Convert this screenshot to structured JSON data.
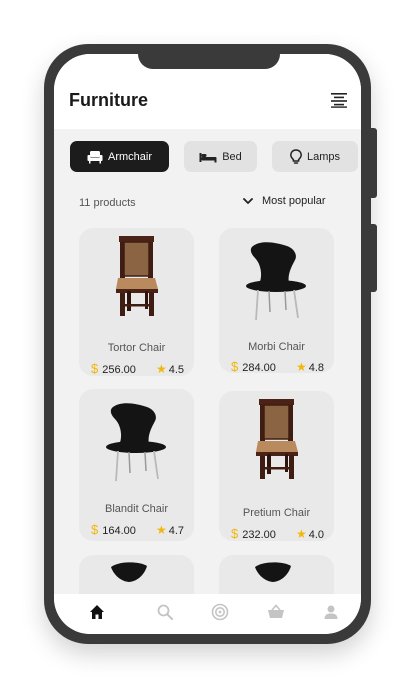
{
  "header": {
    "title": "Furniture"
  },
  "categories": [
    {
      "label": "Armchair",
      "icon": "armchair-icon",
      "active": true
    },
    {
      "label": "Bed",
      "icon": "bed-icon",
      "active": false
    },
    {
      "label": "Lamps",
      "icon": "lamp-icon",
      "active": false
    }
  ],
  "list": {
    "count": "11 products",
    "sort_label": "Most popular"
  },
  "products": [
    {
      "name": "Tortor Chair",
      "currency": "$",
      "price": "256.00",
      "rating": "4.5",
      "image": "wooden-chair"
    },
    {
      "name": "Morbi Chair",
      "currency": "$",
      "price": "284.00",
      "rating": "4.8",
      "image": "black-shell-chair"
    },
    {
      "name": "Blandit Chair",
      "currency": "$",
      "price": "164.00",
      "rating": "4.7",
      "image": "black-shell-chair"
    },
    {
      "name": "Pretium Chair",
      "currency": "$",
      "price": "232.00",
      "rating": "4.0",
      "image": "wooden-chair"
    }
  ],
  "tabs": [
    "home-icon",
    "search-icon",
    "radar-icon",
    "basket-icon",
    "profile-icon"
  ],
  "colors": {
    "accent": "#f1b70f",
    "dark": "#1c1c1c",
    "frame": "#3a3a3a"
  }
}
